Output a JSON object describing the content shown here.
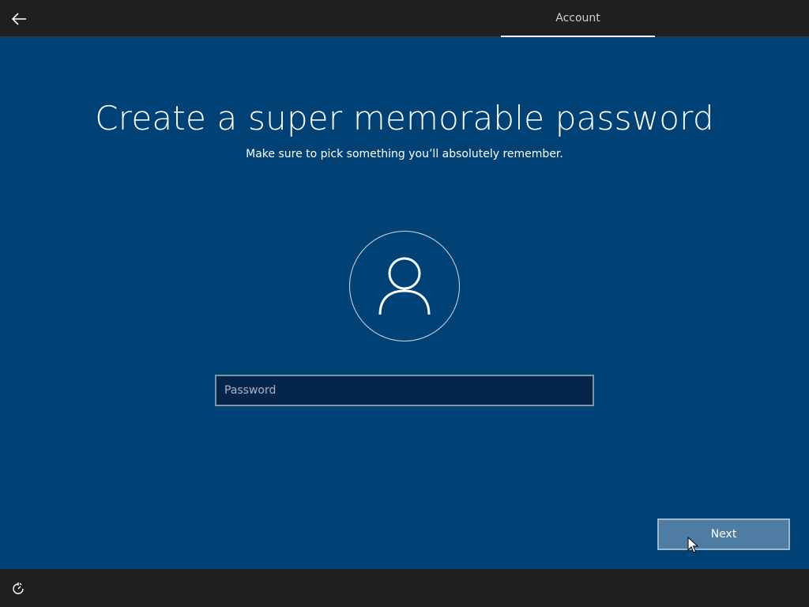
{
  "header": {
    "back_icon": "arrow-left-icon",
    "active_tab": "Account"
  },
  "main": {
    "title": "Create a super memorable password",
    "subtitle": "Make sure to pick something you’ll absolutely remember.",
    "avatar_icon": "user-icon",
    "password_placeholder": "Password",
    "password_value": "",
    "next_label": "Next"
  },
  "footer": {
    "ease_of_access_icon": "ease-of-access-icon"
  },
  "colors": {
    "background": "#004275",
    "bars": "#1f1f1f",
    "input_bg": "#06254a",
    "button_bg": "#4f7ca3"
  }
}
